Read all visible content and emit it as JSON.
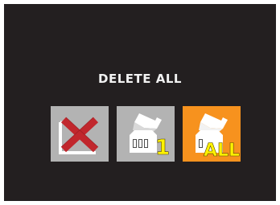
{
  "dialog": {
    "title": "DELETE ALL",
    "options": [
      {
        "name": "cancel",
        "icon": "cancel-x-icon",
        "selected": false
      },
      {
        "name": "delete-one",
        "icon": "memory-card-one-icon",
        "label": "1",
        "selected": false
      },
      {
        "name": "delete-all",
        "icon": "memory-card-all-icon",
        "label": "ALL",
        "selected": true
      }
    ]
  },
  "colors": {
    "screen_background": "#231f20",
    "option_background": "#b3b3b3",
    "selected_background": "#f7921e",
    "cancel_x": "#c1272d",
    "label_yellow": "#fff200"
  }
}
